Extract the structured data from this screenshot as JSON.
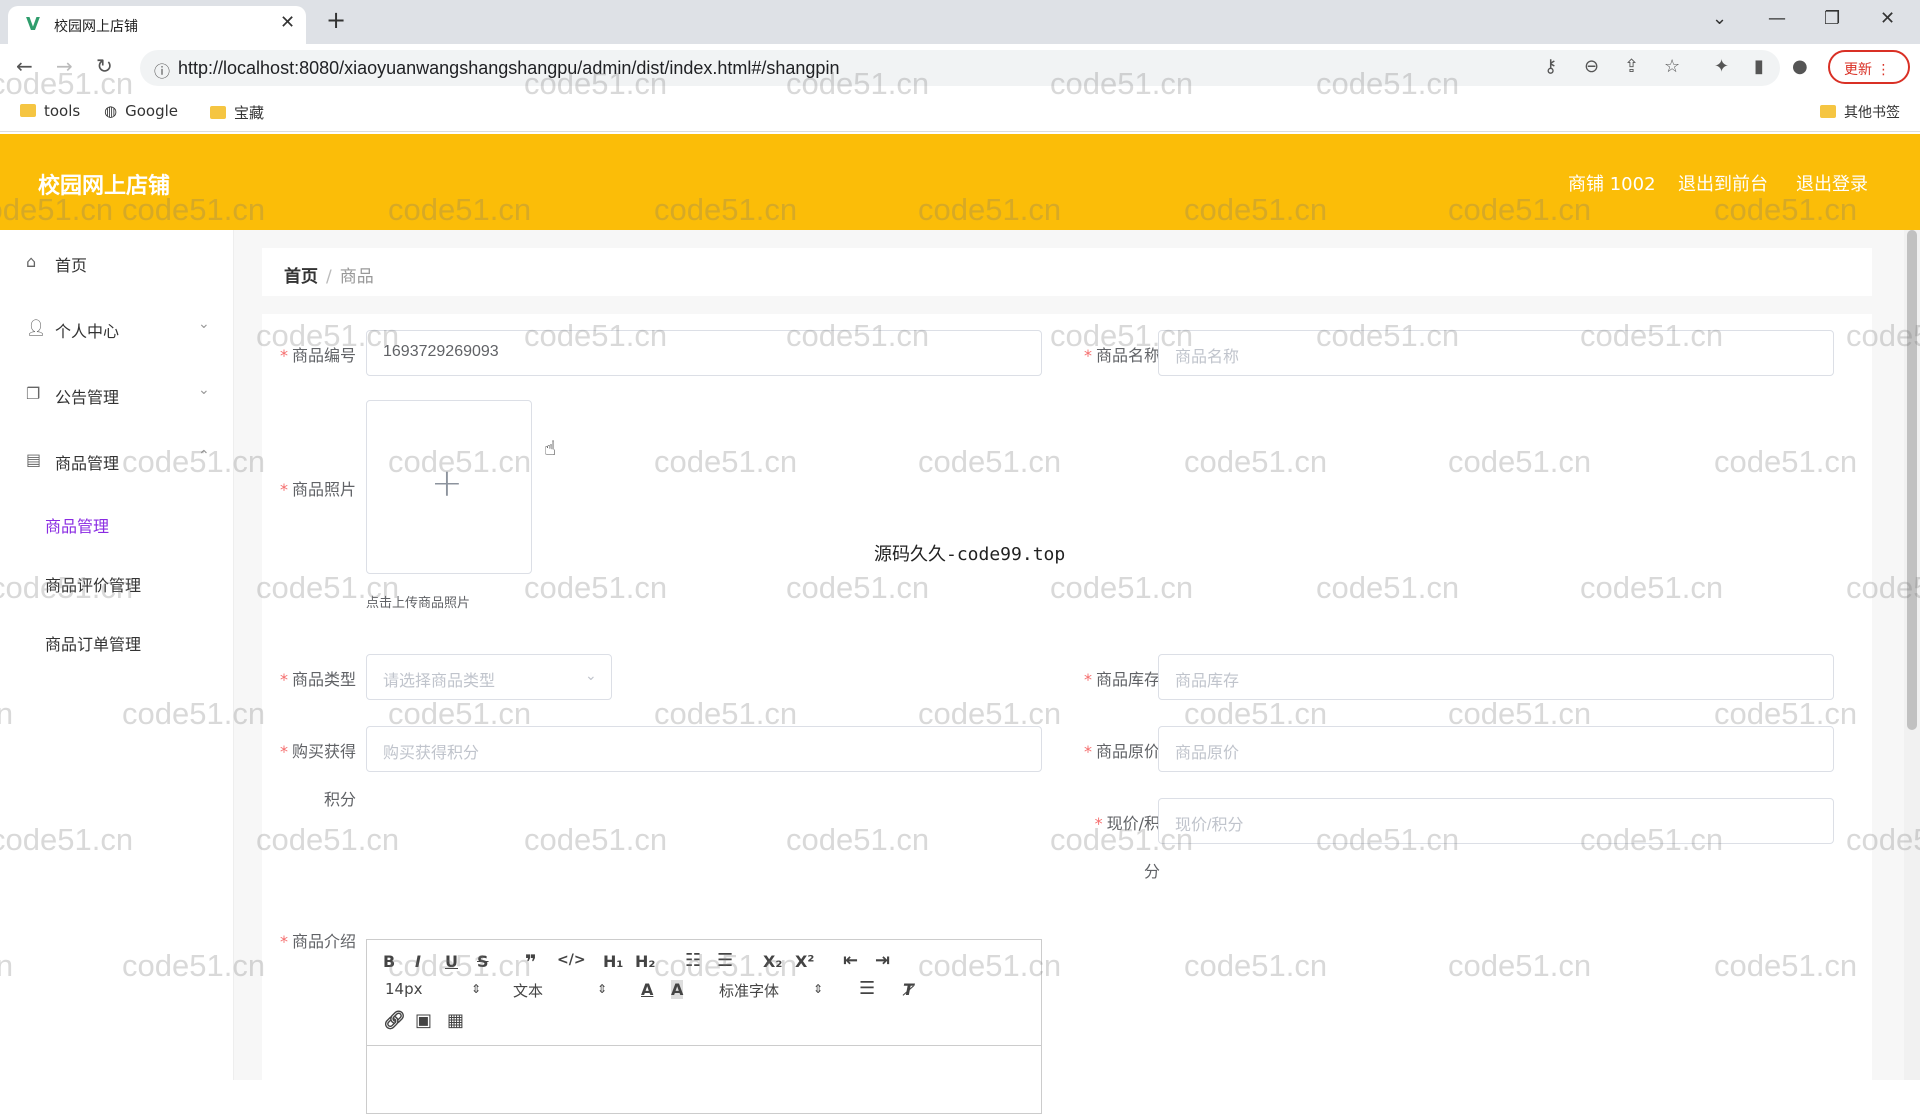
{
  "browser": {
    "tab_title": "校园网上店铺",
    "url": "http://localhost:8080/xiaoyuanwangshangshangpu/admin/dist/index.html#/shangpin",
    "update_label": "更新",
    "bookmarks": [
      "tools",
      "Google",
      "宝藏"
    ],
    "other_bookmarks": "其他书签"
  },
  "header": {
    "title": "校园网上店铺",
    "user": "商铺 1002",
    "back_to_front": "退出到前台",
    "logout": "退出登录",
    "bg_color": "#fbbd08"
  },
  "sidebar": {
    "items": [
      {
        "label": "首页",
        "icon": "home-icon"
      },
      {
        "label": "个人中心",
        "icon": "user-icon"
      },
      {
        "label": "公告管理",
        "icon": "notice-icon"
      },
      {
        "label": "商品管理",
        "icon": "goods-icon"
      }
    ],
    "submenu": [
      "商品管理",
      "商品评价管理",
      "商品订单管理"
    ],
    "active_color": "#8a2be2"
  },
  "breadcrumb": {
    "home": "首页",
    "separator": "/",
    "current": "商品"
  },
  "form": {
    "code_label": "商品编号",
    "code_value": "1693729269093",
    "name_label": "商品名称",
    "name_placeholder": "商品名称",
    "photo_label": "商品照片",
    "photo_hint": "点击上传商品照片",
    "type_label": "商品类型",
    "type_placeholder": "请选择商品类型",
    "stock_label": "商品库存",
    "stock_placeholder": "商品库存",
    "points_label_1": "购买获得",
    "points_label_2": "积分",
    "points_placeholder": "购买获得积分",
    "orig_price_label": "商品原价",
    "orig_price_placeholder": "商品原价",
    "cur_price_label_1": "现价/积",
    "cur_price_label_2": "分",
    "cur_price_placeholder": "现价/积分",
    "intro_label": "商品介绍"
  },
  "editor": {
    "font_size": "14px",
    "text_style": "文本",
    "font_family": "标准字体"
  },
  "center_text": "源码久久-code99.top",
  "watermark": "code51.cn"
}
